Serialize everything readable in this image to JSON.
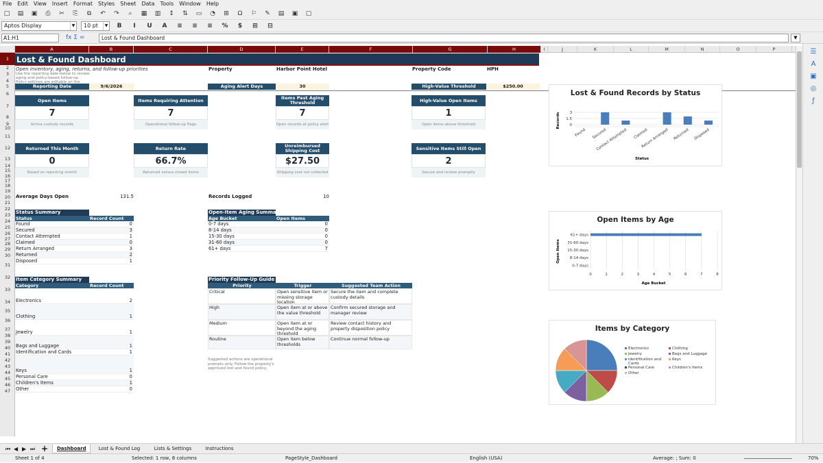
{
  "menu": [
    "File",
    "Edit",
    "View",
    "Insert",
    "Format",
    "Styles",
    "Sheet",
    "Data",
    "Tools",
    "Window",
    "Help"
  ],
  "toolbar": {
    "font_name": "Aptos Display",
    "font_size": "10 pt"
  },
  "formula_bar": {
    "name_box": "A1:H1",
    "fx": "fx  Σ  =",
    "content": "Lost & Found Dashboard"
  },
  "columns": [
    "A",
    "B",
    "C",
    "D",
    "E",
    "F",
    "G",
    "H",
    "I",
    "J",
    "K",
    "L",
    "M",
    "N",
    "O",
    "P"
  ],
  "rows": [
    "1",
    "2",
    "3",
    "4",
    "5",
    "6",
    "7",
    "8",
    "9",
    "10",
    "11",
    "12",
    "13",
    "14",
    "15",
    "16",
    "17",
    "18",
    "19",
    "20",
    "21",
    "22",
    "23",
    "24",
    "25",
    "26",
    "27",
    "28",
    "29",
    "30",
    "31",
    "32",
    "33",
    "34",
    "35",
    "36",
    "37",
    "38",
    "39",
    "40",
    "41",
    "42",
    "43",
    "44",
    "45",
    "46",
    "47"
  ],
  "dashboard": {
    "title": "Lost & Found Dashboard",
    "subtitle": "Open inventory, aging, returns, and follow-up priorities",
    "note": "Use the reporting date below to review aging and policy-based follow-up. Policy settings are editable on the",
    "property_label": "Property",
    "property_value": "Harbor Point Hotel",
    "property_code_label": "Property Code",
    "property_code_value": "HPH",
    "reporting_date_label": "Reporting Date",
    "reporting_date_value": "9/6/2026",
    "aging_label": "Aging Alert Days",
    "aging_value": "30",
    "hv_label": "High-Value Threshold",
    "hv_value": "$250.00"
  },
  "kpis": [
    {
      "header": "Open Items",
      "value": "7",
      "note": "Active custody records"
    },
    {
      "header": "Items Requiring Attention",
      "value": "7",
      "note": "Operational follow-up flags"
    },
    {
      "header": "Items Past Aging Threshold",
      "value": "7",
      "note": "Open records at policy alert"
    },
    {
      "header": "High-Value Open Items",
      "value": "1",
      "note": "Open items above threshold"
    },
    {
      "header": "Returned This Month",
      "value": "0",
      "note": "Based on reporting month"
    },
    {
      "header": "Return Rate",
      "value": "66.7%",
      "note": "Returned versus closed items"
    },
    {
      "header": "Unreimbursed Shipping Cost",
      "value": "$27.50",
      "note": "Shipping cost not collected"
    },
    {
      "header": "Sensitive Items Still Open",
      "value": "2",
      "note": "Secure and review promptly"
    }
  ],
  "avg_days": {
    "label": "Average Days Open",
    "value": "131.5"
  },
  "records_logged": {
    "label": "Records Logged",
    "value": "10"
  },
  "status_summary": {
    "title": "Status Summary",
    "headers": [
      "Status",
      "Record Count"
    ],
    "rows": [
      [
        "Found",
        "0"
      ],
      [
        "Secured",
        "3"
      ],
      [
        "Contact Attempted",
        "1"
      ],
      [
        "Claimed",
        "0"
      ],
      [
        "Return Arranged",
        "3"
      ],
      [
        "Returned",
        "2"
      ],
      [
        "Disposed",
        "1"
      ]
    ]
  },
  "aging_summary": {
    "title": "Open-Item Aging Summary",
    "headers": [
      "Age Bucket",
      "Open Items"
    ],
    "rows": [
      [
        "0-7 days",
        "0"
      ],
      [
        "8-14 days",
        "0"
      ],
      [
        "15-30 days",
        "0"
      ],
      [
        "31-60 days",
        "0"
      ],
      [
        "61+ days",
        "7"
      ]
    ]
  },
  "category_summary": {
    "title": "Item Category Summary",
    "headers": [
      "Category",
      "Record Count"
    ],
    "rows": [
      [
        "Electronics",
        "2"
      ],
      [
        "Clothing",
        "1"
      ],
      [
        "Jewelry",
        "1"
      ],
      [
        "Bags and Luggage",
        "1"
      ],
      [
        "Identification and Cards",
        "1"
      ],
      [
        "Keys",
        "1"
      ],
      [
        "Personal Care",
        "0"
      ],
      [
        "Children's Items",
        "1"
      ],
      [
        "Other",
        "0"
      ]
    ]
  },
  "priority_guide": {
    "title": "Priority Follow-Up Guide",
    "headers": [
      "Priority",
      "Trigger",
      "Suggested Team Action"
    ],
    "rows": [
      [
        "Critical",
        "Open sensitive item or missing storage location",
        "Secure the item and complete custody details"
      ],
      [
        "High",
        "Open item at or above the value threshold",
        "Confirm secured storage and manager review"
      ],
      [
        "Medium",
        "Open item at or beyond the aging threshold",
        "Review contact history and property disposition policy"
      ],
      [
        "Routine",
        "Open item below thresholds",
        "Continue normal follow-up"
      ]
    ],
    "note": "Suggested actions are operational prompts only. Follow the property's approved lost and found policy."
  },
  "chart_data": [
    {
      "type": "bar",
      "title": "Lost & Found Records by Status",
      "xlabel": "Status",
      "ylabel": "Records",
      "categories": [
        "Found",
        "Secured",
        "Contact Attempted",
        "Claimed",
        "Return Arranged",
        "Returned",
        "Disposed"
      ],
      "values": [
        0,
        3,
        1,
        0,
        3,
        2,
        1
      ],
      "ylim": [
        0,
        3
      ],
      "yticks": [
        "0",
        "1.5",
        "3"
      ],
      "color": "#4a7ebb"
    },
    {
      "type": "bar",
      "orientation": "horizontal",
      "title": "Open Items by Age",
      "xlabel": "Age Bucket",
      "ylabel": "Open Items",
      "categories": [
        "0-7 days",
        "8-14 days",
        "15-30 days",
        "31-60 days",
        "61+ days"
      ],
      "values": [
        0,
        0,
        0,
        0,
        7
      ],
      "xlim": [
        0,
        8
      ],
      "xticks": [
        "0",
        "1",
        "2",
        "3",
        "4",
        "5",
        "6",
        "7",
        "8"
      ],
      "color": "#4a7ebb"
    },
    {
      "type": "pie",
      "title": "Items by Category",
      "categories": [
        "Electronics",
        "Clothing",
        "Jewelry",
        "Bags and Luggage",
        "Identification and Cards",
        "Keys",
        "Personal Care",
        "Children's Items",
        "Other"
      ],
      "values": [
        2,
        1,
        1,
        1,
        1,
        1,
        0,
        1,
        0
      ],
      "colors": [
        "#4a7ebb",
        "#be4b48",
        "#98b954",
        "#7d60a0",
        "#46aac4",
        "#f59d56",
        "#2c4d75",
        "#d99594",
        "#b5c88c"
      ]
    }
  ],
  "sheet_tabs": [
    "Dashboard",
    "Lost & Found Log",
    "Lists & Settings",
    "Instructions"
  ],
  "status_bar": {
    "sheet": "Sheet 1 of 4",
    "selection": "Selected: 1 row, 8 columns",
    "page_style": "PageStyle_Dashboard",
    "language": "English (USA)",
    "summary": "Average: ; Sum: 0",
    "zoom": "70%"
  }
}
